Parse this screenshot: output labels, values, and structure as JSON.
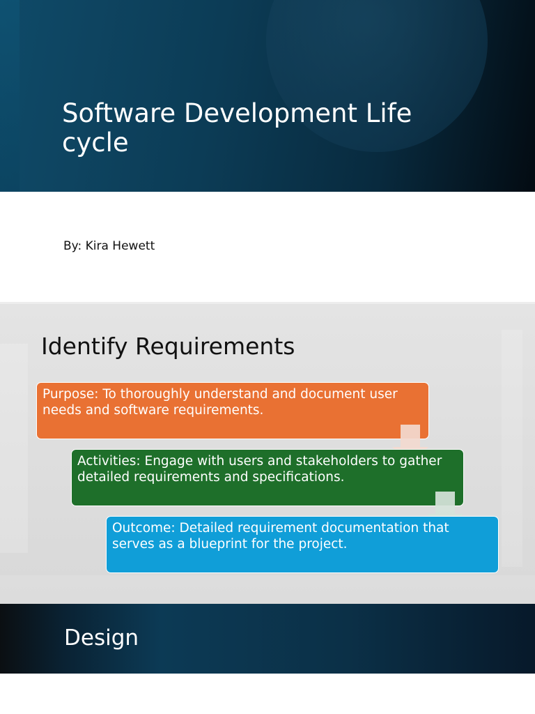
{
  "slides": [
    {
      "title": "Software Development Life cycle",
      "subtitle": "By: Kira Hewett"
    },
    {
      "title": "Identify Requirements",
      "steps": [
        {
          "text": "Purpose: To thoroughly understand and document user needs and software requirements.",
          "color": "#e97133"
        },
        {
          "text": "Activities: Engage with users and stakeholders to gather detailed requirements and specifications.",
          "color": "#1e6f2a"
        },
        {
          "text": "Outcome: Detailed requirement documentation that serves as a blueprint for the project.",
          "color": "#109ed8"
        }
      ]
    },
    {
      "title": "Design"
    }
  ],
  "colors": {
    "title_band": "#0c3c56",
    "arrow": "#f2d9cf"
  },
  "icons": [
    "down-arrow-icon"
  ]
}
